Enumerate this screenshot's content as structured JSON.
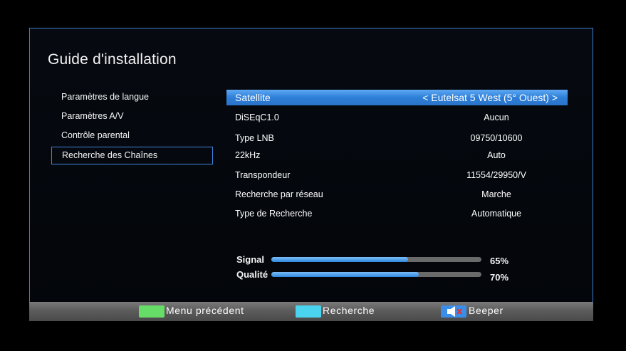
{
  "title": "Guide d'installation",
  "menu": [
    {
      "label": "Paramètres de langue"
    },
    {
      "label": "Paramètres A/V"
    },
    {
      "label": "Contrôle parental"
    },
    {
      "label": "Recherche des Chaînes"
    }
  ],
  "settings": [
    {
      "label": "Satellite",
      "value": "< Eutelsat 5 West (5° Ouest) >"
    },
    {
      "label": "DiSEqC1.0",
      "value": "Aucun"
    },
    {
      "label": "Type LNB",
      "value": "09750/10600"
    },
    {
      "label": "22kHz",
      "value": "Auto"
    },
    {
      "label": "Transpondeur",
      "value": "11554/29950/V"
    },
    {
      "label": "Recherche par réseau",
      "value": "Marche"
    },
    {
      "label": "Type de Recherche",
      "value": "Automatique"
    }
  ],
  "signal": {
    "label": "Signal",
    "percent_text": "65%",
    "level": 0.65
  },
  "quality": {
    "label": "Qualité",
    "percent_text": "70%",
    "level": 0.7
  },
  "footer": {
    "prev": {
      "label": "Menu précédent",
      "color": "#66dd66"
    },
    "search": {
      "label": "Recherche",
      "color": "#4ad4f0"
    },
    "beeper": {
      "label": "Beeper",
      "color": "#3a8ee8"
    }
  },
  "colors": {
    "accent": "#3f86e0",
    "highlight": "#4a96ec"
  }
}
